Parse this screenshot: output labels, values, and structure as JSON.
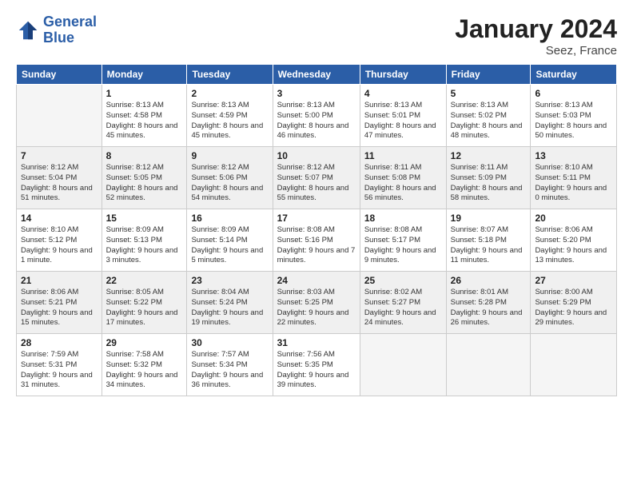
{
  "logo": {
    "line1": "General",
    "line2": "Blue"
  },
  "title": "January 2024",
  "subtitle": "Seez, France",
  "weekdays": [
    "Sunday",
    "Monday",
    "Tuesday",
    "Wednesday",
    "Thursday",
    "Friday",
    "Saturday"
  ],
  "weeks": [
    [
      {
        "day": "",
        "empty": true
      },
      {
        "day": "1",
        "sunrise": "8:13 AM",
        "sunset": "4:58 PM",
        "daylight": "8 hours and 45 minutes."
      },
      {
        "day": "2",
        "sunrise": "8:13 AM",
        "sunset": "4:59 PM",
        "daylight": "8 hours and 45 minutes."
      },
      {
        "day": "3",
        "sunrise": "8:13 AM",
        "sunset": "5:00 PM",
        "daylight": "8 hours and 46 minutes."
      },
      {
        "day": "4",
        "sunrise": "8:13 AM",
        "sunset": "5:01 PM",
        "daylight": "8 hours and 47 minutes."
      },
      {
        "day": "5",
        "sunrise": "8:13 AM",
        "sunset": "5:02 PM",
        "daylight": "8 hours and 48 minutes."
      },
      {
        "day": "6",
        "sunrise": "8:13 AM",
        "sunset": "5:03 PM",
        "daylight": "8 hours and 50 minutes."
      }
    ],
    [
      {
        "day": "7",
        "sunrise": "8:12 AM",
        "sunset": "5:04 PM",
        "daylight": "8 hours and 51 minutes."
      },
      {
        "day": "8",
        "sunrise": "8:12 AM",
        "sunset": "5:05 PM",
        "daylight": "8 hours and 52 minutes."
      },
      {
        "day": "9",
        "sunrise": "8:12 AM",
        "sunset": "5:06 PM",
        "daylight": "8 hours and 54 minutes."
      },
      {
        "day": "10",
        "sunrise": "8:12 AM",
        "sunset": "5:07 PM",
        "daylight": "8 hours and 55 minutes."
      },
      {
        "day": "11",
        "sunrise": "8:11 AM",
        "sunset": "5:08 PM",
        "daylight": "8 hours and 56 minutes."
      },
      {
        "day": "12",
        "sunrise": "8:11 AM",
        "sunset": "5:09 PM",
        "daylight": "8 hours and 58 minutes."
      },
      {
        "day": "13",
        "sunrise": "8:10 AM",
        "sunset": "5:11 PM",
        "daylight": "9 hours and 0 minutes."
      }
    ],
    [
      {
        "day": "14",
        "sunrise": "8:10 AM",
        "sunset": "5:12 PM",
        "daylight": "9 hours and 1 minute."
      },
      {
        "day": "15",
        "sunrise": "8:09 AM",
        "sunset": "5:13 PM",
        "daylight": "9 hours and 3 minutes."
      },
      {
        "day": "16",
        "sunrise": "8:09 AM",
        "sunset": "5:14 PM",
        "daylight": "9 hours and 5 minutes."
      },
      {
        "day": "17",
        "sunrise": "8:08 AM",
        "sunset": "5:16 PM",
        "daylight": "9 hours and 7 minutes."
      },
      {
        "day": "18",
        "sunrise": "8:08 AM",
        "sunset": "5:17 PM",
        "daylight": "9 hours and 9 minutes."
      },
      {
        "day": "19",
        "sunrise": "8:07 AM",
        "sunset": "5:18 PM",
        "daylight": "9 hours and 11 minutes."
      },
      {
        "day": "20",
        "sunrise": "8:06 AM",
        "sunset": "5:20 PM",
        "daylight": "9 hours and 13 minutes."
      }
    ],
    [
      {
        "day": "21",
        "sunrise": "8:06 AM",
        "sunset": "5:21 PM",
        "daylight": "9 hours and 15 minutes."
      },
      {
        "day": "22",
        "sunrise": "8:05 AM",
        "sunset": "5:22 PM",
        "daylight": "9 hours and 17 minutes."
      },
      {
        "day": "23",
        "sunrise": "8:04 AM",
        "sunset": "5:24 PM",
        "daylight": "9 hours and 19 minutes."
      },
      {
        "day": "24",
        "sunrise": "8:03 AM",
        "sunset": "5:25 PM",
        "daylight": "9 hours and 22 minutes."
      },
      {
        "day": "25",
        "sunrise": "8:02 AM",
        "sunset": "5:27 PM",
        "daylight": "9 hours and 24 minutes."
      },
      {
        "day": "26",
        "sunrise": "8:01 AM",
        "sunset": "5:28 PM",
        "daylight": "9 hours and 26 minutes."
      },
      {
        "day": "27",
        "sunrise": "8:00 AM",
        "sunset": "5:29 PM",
        "daylight": "9 hours and 29 minutes."
      }
    ],
    [
      {
        "day": "28",
        "sunrise": "7:59 AM",
        "sunset": "5:31 PM",
        "daylight": "9 hours and 31 minutes."
      },
      {
        "day": "29",
        "sunrise": "7:58 AM",
        "sunset": "5:32 PM",
        "daylight": "9 hours and 34 minutes."
      },
      {
        "day": "30",
        "sunrise": "7:57 AM",
        "sunset": "5:34 PM",
        "daylight": "9 hours and 36 minutes."
      },
      {
        "day": "31",
        "sunrise": "7:56 AM",
        "sunset": "5:35 PM",
        "daylight": "9 hours and 39 minutes."
      },
      {
        "day": "",
        "empty": true
      },
      {
        "day": "",
        "empty": true
      },
      {
        "day": "",
        "empty": true
      }
    ]
  ],
  "labels": {
    "sunrise_prefix": "Sunrise: ",
    "sunset_prefix": "Sunset: ",
    "daylight_prefix": "Daylight: "
  }
}
